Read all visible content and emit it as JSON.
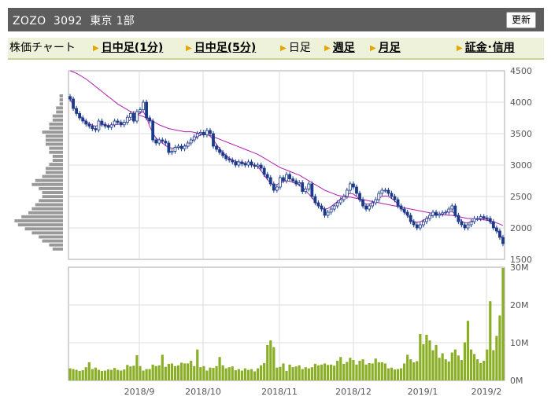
{
  "header": {
    "title": "ZOZO  3092  東京 1部",
    "refresh_label": "更新"
  },
  "nav": {
    "items": [
      {
        "label": "株価チャート",
        "arrow": false,
        "link": false
      },
      {
        "label": "日中足(1分)",
        "arrow": true,
        "link": true
      },
      {
        "label": "日中足(5分)",
        "arrow": true,
        "link": true
      },
      {
        "label": "日足",
        "arrow": true,
        "link": false
      },
      {
        "label": "週足",
        "arrow": true,
        "link": true
      },
      {
        "label": "月足",
        "arrow": true,
        "link": true
      },
      {
        "label": "証金･信用",
        "arrow": true,
        "link": true
      }
    ]
  },
  "chart_data": [
    {
      "type": "candlestick",
      "title": "",
      "ylim": [
        1500,
        4500
      ],
      "yticks": [
        "4500",
        "4000",
        "3500",
        "3000",
        "2500",
        "2000",
        "1500"
      ],
      "x_labels": [
        "2018/9",
        "2018/10",
        "2018/11",
        "2018/12",
        "2019/1",
        "2019/2"
      ],
      "close": [
        4050,
        3900,
        3820,
        3750,
        3700,
        3650,
        3620,
        3580,
        3560,
        3700,
        3650,
        3620,
        3600,
        3640,
        3700,
        3680,
        3640,
        3680,
        3760,
        3820,
        3700,
        3850,
        3880,
        4000,
        3750,
        3700,
        3400,
        3350,
        3400,
        3380,
        3350,
        3200,
        3220,
        3280,
        3300,
        3260,
        3300,
        3350,
        3400,
        3450,
        3500,
        3520,
        3480,
        3550,
        3500,
        3300,
        3250,
        3200,
        3150,
        3100,
        3080,
        3050,
        3000,
        3050,
        3020,
        3000,
        3050,
        3000,
        2980,
        3000,
        2950,
        2850,
        2800,
        2700,
        2600,
        2650,
        2800,
        2750,
        2850,
        2780,
        2750,
        2700,
        2720,
        2580,
        2620,
        2700,
        2500,
        2400,
        2350,
        2300,
        2200,
        2250,
        2300,
        2350,
        2400,
        2450,
        2500,
        2600,
        2700,
        2650,
        2550,
        2450,
        2350,
        2300,
        2350,
        2400,
        2450,
        2550,
        2600,
        2600,
        2550,
        2500,
        2450,
        2350,
        2300,
        2250,
        2200,
        2100,
        2050,
        2000,
        2050,
        2100,
        2150,
        2200,
        2250,
        2200,
        2220,
        2240,
        2250,
        2300,
        2350,
        2200,
        2100,
        2050,
        2000,
        2050,
        2100,
        2150,
        2150,
        2180,
        2160,
        2150,
        2100,
        2000,
        1950,
        1850,
        1750
      ],
      "ma_short": [
        4060,
        3940,
        3850,
        3790,
        3740,
        3690,
        3660,
        3630,
        3620,
        3630,
        3640,
        3640,
        3630,
        3630,
        3640,
        3650,
        3650,
        3660,
        3690,
        3720,
        3740,
        3790,
        3830,
        3850,
        3760,
        3620,
        3510,
        3430,
        3390,
        3350,
        3310,
        3280,
        3270,
        3270,
        3280,
        3290,
        3300,
        3330,
        3370,
        3410,
        3450,
        3480,
        3490,
        3490,
        3460,
        3400,
        3330,
        3260,
        3200,
        3150,
        3110,
        3080,
        3060,
        3050,
        3040,
        3030,
        3020,
        3010,
        3000,
        2970,
        2910,
        2840,
        2770,
        2710,
        2680,
        2690,
        2720,
        2740,
        2750,
        2740,
        2730,
        2710,
        2680,
        2640,
        2590,
        2540,
        2480,
        2420,
        2370,
        2320,
        2300,
        2310,
        2340,
        2380,
        2420,
        2460,
        2500,
        2530,
        2550,
        2540,
        2500,
        2450,
        2400,
        2380,
        2380,
        2400,
        2430,
        2470,
        2500,
        2510,
        2500,
        2470,
        2430,
        2380,
        2320,
        2260,
        2200,
        2140,
        2100,
        2090,
        2100,
        2120,
        2150,
        2180,
        2200,
        2210,
        2220,
        2230,
        2250,
        2270,
        2260,
        2220,
        2160,
        2110,
        2080,
        2080,
        2100,
        2120,
        2140,
        2150,
        2150,
        2140,
        2100,
        2040,
        1970,
        1900,
        1830
      ],
      "ma_long": [
        4500,
        4480,
        4460,
        4430,
        4400,
        4370,
        4330,
        4290,
        4250,
        4210,
        4170,
        4130,
        4090,
        4050,
        4010,
        3970,
        3940,
        3910,
        3880,
        3850,
        3830,
        3810,
        3790,
        3770,
        3750,
        3730,
        3700,
        3670,
        3640,
        3620,
        3600,
        3580,
        3570,
        3560,
        3550,
        3540,
        3530,
        3530,
        3530,
        3520,
        3510,
        3500,
        3490,
        3480,
        3470,
        3450,
        3430,
        3410,
        3390,
        3370,
        3350,
        3330,
        3310,
        3290,
        3270,
        3250,
        3230,
        3210,
        3190,
        3170,
        3140,
        3110,
        3080,
        3050,
        3020,
        2990,
        2960,
        2940,
        2920,
        2900,
        2880,
        2860,
        2840,
        2810,
        2780,
        2750,
        2720,
        2690,
        2660,
        2630,
        2600,
        2580,
        2560,
        2540,
        2520,
        2510,
        2500,
        2490,
        2490,
        2480,
        2470,
        2460,
        2450,
        2440,
        2430,
        2420,
        2410,
        2400,
        2390,
        2380,
        2370,
        2360,
        2350,
        2340,
        2330,
        2320,
        2310,
        2300,
        2290,
        2280,
        2270,
        2260,
        2250,
        2240,
        2230,
        2220,
        2220,
        2210,
        2210,
        2200,
        2200,
        2190,
        2180,
        2170,
        2160,
        2150,
        2150,
        2140,
        2140,
        2130,
        2130,
        2120,
        2110,
        2100,
        2080,
        2060,
        2040
      ]
    },
    {
      "type": "bar",
      "title": "",
      "ylim": [
        0,
        30
      ],
      "yticks": [
        "30M",
        "20M",
        "10M",
        "0M"
      ],
      "x_labels": [
        "2018/9",
        "2018/10",
        "2018/11",
        "2018/12",
        "2019/1",
        "2019/2"
      ],
      "values": [
        3.2,
        3.0,
        2.8,
        2.5,
        2.7,
        3.5,
        4.8,
        3.0,
        3.4,
        2.8,
        2.5,
        2.6,
        2.9,
        2.8,
        3.3,
        2.8,
        2.6,
        2.9,
        4.1,
        3.7,
        3.9,
        6.7,
        3.8,
        2.6,
        3.0,
        3.0,
        4.2,
        3.8,
        4.0,
        6.8,
        3.6,
        4.4,
        4.5,
        3.8,
        4.0,
        4.7,
        4.5,
        4.5,
        5.2,
        3.8,
        8.2,
        3.5,
        3.8,
        2.6,
        3.4,
        3.3,
        3.8,
        6.2,
        4.0,
        3.2,
        3.5,
        3.7,
        2.7,
        3.0,
        2.6,
        3.2,
        2.8,
        3.0,
        2.4,
        3.2,
        4.0,
        4.6,
        9.4,
        10.6,
        8.8,
        3.4,
        3.6,
        4.5,
        2.5,
        4.2,
        3.5,
        3.7,
        4.0,
        3.0,
        3.5,
        3.2,
        3.5,
        4.4,
        4.0,
        4.2,
        4.5,
        4.1,
        4.2,
        3.9,
        5.2,
        6.2,
        4.4,
        4.9,
        6.0,
        5.4,
        4.2,
        5.2,
        5.6,
        4.2,
        4.6,
        4.5,
        5.8,
        4.8,
        4.8,
        4.5,
        3.2,
        3.4,
        2.9,
        3.0,
        3.2,
        4.5,
        6.8,
        5.6,
        4.8,
        5.1,
        12.3,
        9.6,
        12.1,
        10.6,
        8.0,
        9.4,
        6.0,
        7.2,
        5.6,
        5.0,
        7.4,
        8.2,
        6.6,
        5.4,
        10.1,
        15.8,
        8.2,
        7.0,
        5.6,
        4.6,
        5.2,
        8.2,
        21.0,
        8.0,
        11.8,
        17.2,
        29.8
      ]
    }
  ],
  "depth_profile": [
    1,
    1,
    1,
    2,
    2,
    3,
    3,
    4,
    4,
    6,
    5,
    5,
    5,
    4,
    4,
    3,
    3,
    4,
    5,
    5,
    6,
    8,
    9,
    7,
    6,
    6,
    7,
    8,
    9,
    10,
    12,
    14,
    13,
    11,
    9,
    7,
    6,
    4,
    3
  ]
}
